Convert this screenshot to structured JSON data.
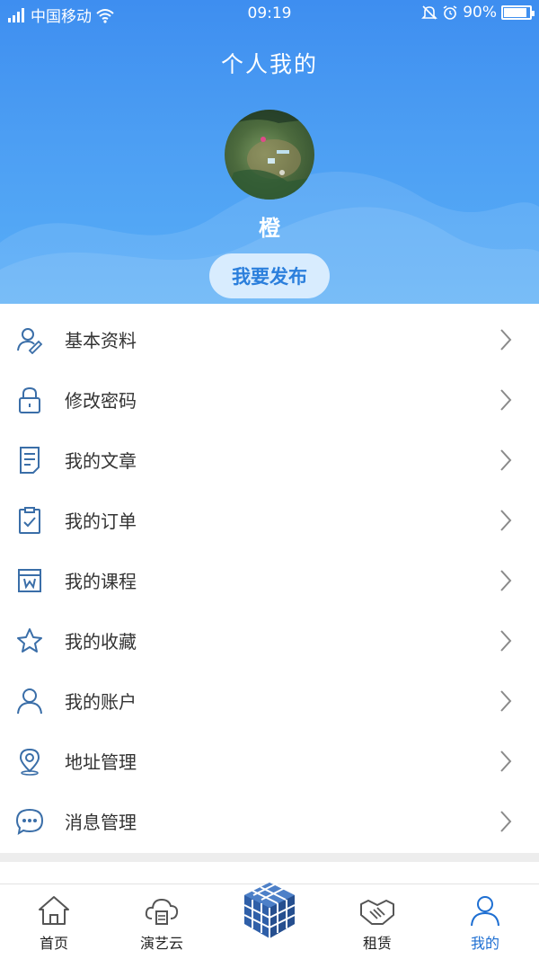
{
  "status_bar": {
    "network": "中国移动",
    "time": "09:19",
    "battery_percent": "90%",
    "battery_level": 0.9
  },
  "header": {
    "title": "个人我的",
    "username": "橙",
    "publish_label": "我要发布"
  },
  "menu": [
    {
      "label": "基本资料",
      "icon": "profile-edit-icon"
    },
    {
      "label": "修改密码",
      "icon": "lock-icon"
    },
    {
      "label": "我的文章",
      "icon": "document-icon"
    },
    {
      "label": "我的订单",
      "icon": "clipboard-check-icon"
    },
    {
      "label": "我的课程",
      "icon": "course-icon"
    },
    {
      "label": "我的收藏",
      "icon": "star-icon"
    },
    {
      "label": "我的账户",
      "icon": "user-icon"
    },
    {
      "label": "地址管理",
      "icon": "location-pin-icon"
    },
    {
      "label": "消息管理",
      "icon": "chat-bubble-icon"
    }
  ],
  "tabbar": {
    "tabs": [
      {
        "label": "首页",
        "icon": "home-icon"
      },
      {
        "label": "演艺云",
        "icon": "cloud-icon"
      },
      {
        "label": "",
        "icon": "cube-icon"
      },
      {
        "label": "租赁",
        "icon": "handshake-icon"
      },
      {
        "label": "我的",
        "icon": "user-icon"
      }
    ],
    "active": "我的"
  },
  "colors": {
    "header_blue": "#4c9ef3",
    "accent": "#1e6fd2",
    "icon_blue": "#3a6ea8"
  }
}
